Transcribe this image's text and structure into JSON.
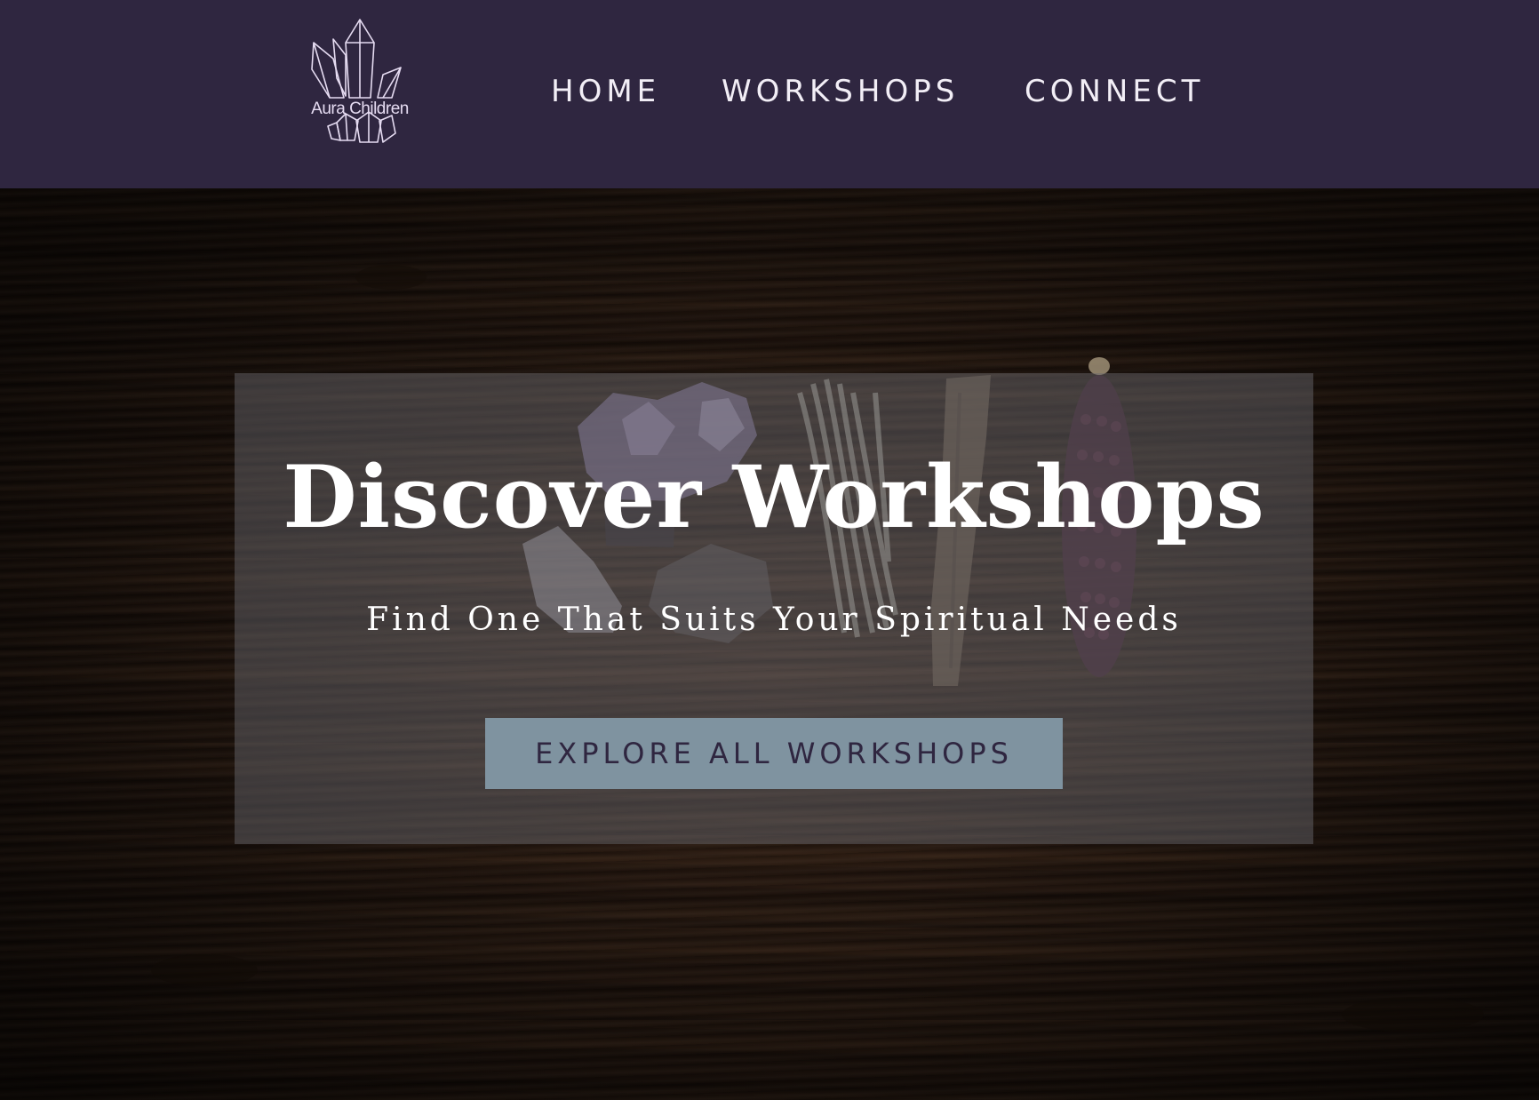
{
  "header": {
    "logo_text": "Aura Children",
    "logo_icon": "crystal-cluster-icon",
    "background_color": "#2f2640"
  },
  "nav": {
    "items": [
      {
        "label": "HOME"
      },
      {
        "label": "WORKSHOPS"
      },
      {
        "label": "CONNECT"
      }
    ]
  },
  "hero": {
    "title": "Discover Workshops",
    "subtitle": "Find One That Suits Your Spiritual Needs",
    "cta_label": "EXPLORE ALL WORKSHOPS",
    "cta_color": "#7f93a0",
    "background_image": "dark-wood-with-crystals-sage-palo-santo-corn"
  }
}
